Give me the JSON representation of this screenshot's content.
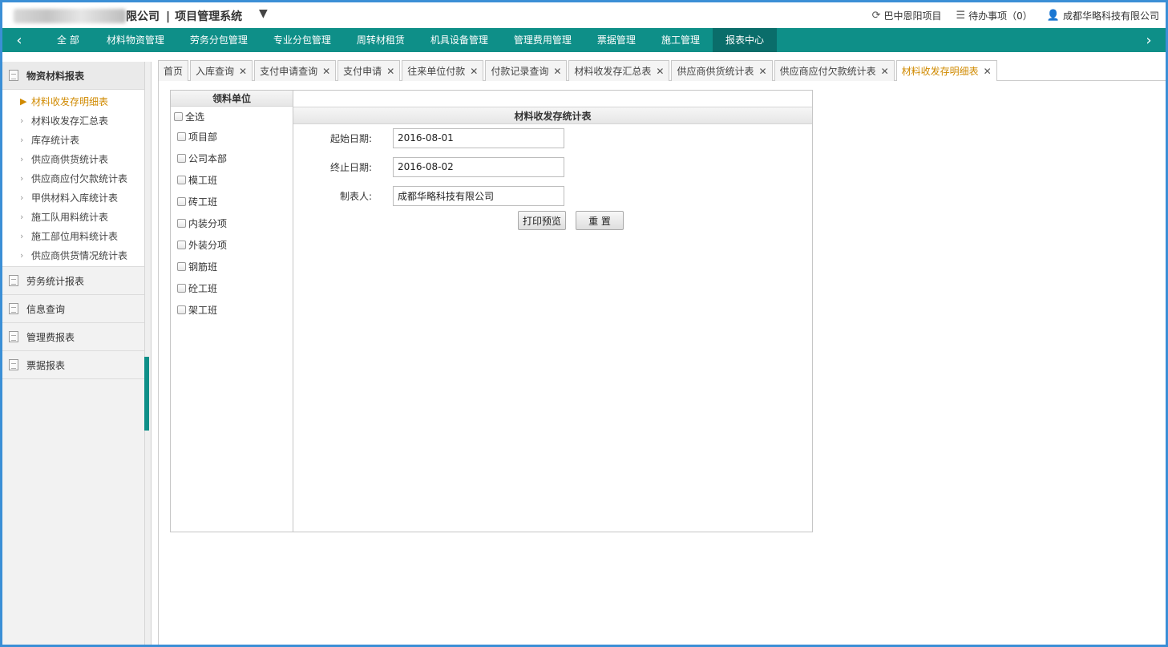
{
  "header": {
    "company": "限公司",
    "system_name": "项目管理系统",
    "separator": "|",
    "project": "巴中恩阳项目",
    "todo": "待办事项（0）",
    "user": "成都华略科技有限公司"
  },
  "nav": {
    "items": [
      "全 部",
      "材料物资管理",
      "劳务分包管理",
      "专业分包管理",
      "周转材租赁",
      "机具设备管理",
      "管理费用管理",
      "票据管理",
      "施工管理",
      "报表中心"
    ],
    "active_index": 9
  },
  "sidebar": {
    "groups": [
      {
        "label": "物资材料报表"
      },
      {
        "label": "劳务统计报表"
      },
      {
        "label": "信息查询"
      },
      {
        "label": "管理费报表"
      },
      {
        "label": "票据报表"
      }
    ],
    "sub_items": [
      "材料收发存明细表",
      "材料收发存汇总表",
      "库存统计表",
      "供应商供货统计表",
      "供应商应付欠款统计表",
      "甲供材料入库统计表",
      "施工队用料统计表",
      "施工部位用料统计表",
      "供应商供货情况统计表"
    ]
  },
  "tabs": [
    "首页",
    "入库查询",
    "支付申请查询",
    "支付申请",
    "往来单位付款",
    "付款记录查询",
    "材料收发存汇总表",
    "供应商供货统计表",
    "供应商应付欠款统计表",
    "材料收发存明细表"
  ],
  "panel": {
    "unit_header": "领料单位",
    "units": [
      "全选",
      "项目部",
      "公司本部",
      "模工班",
      "砖工班",
      "内装分项",
      "外装分项",
      "钢筋班",
      "砼工班",
      "架工班"
    ],
    "form_title": "材料收发存统计表",
    "start_label": "起始日期:",
    "start_value": "2016-08-01",
    "end_label": "终止日期:",
    "end_value": "2016-08-02",
    "maker_label": "制表人:",
    "maker_value": "成都华略科技有限公司",
    "print_btn": "打印预览",
    "reset_btn": "重 置"
  },
  "colors": {
    "nav": "#0e8f88",
    "nav_active": "#0a6d6a",
    "accent": "#d08a00",
    "frame": "#3b8fd6"
  }
}
